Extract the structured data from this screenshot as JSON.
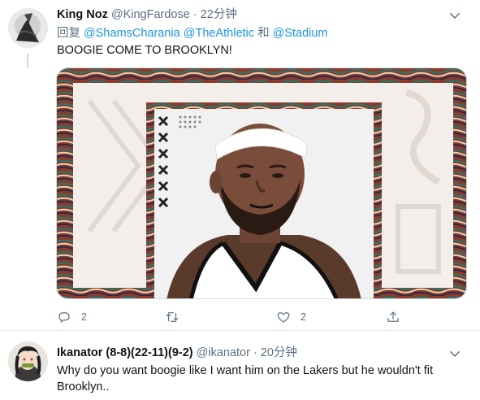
{
  "tweet1": {
    "display_name": "King Noz",
    "handle": "@KingFardose",
    "separator": "·",
    "time": "22分钟",
    "reply_prefix": "回复",
    "mention_1": "@ShamsCharania",
    "mention_2": "@TheAthletic",
    "conjunction": "和",
    "mention_3": "@Stadium",
    "text": "BOOGIE COME TO BROOKLYN!",
    "actions": {
      "reply_count": "2",
      "retweet_count": "",
      "like_count": "2"
    }
  },
  "tweet2": {
    "display_name": "Ikanator (8-8)(22-11)(9-2)",
    "handle": "@ikanator",
    "separator": "·",
    "time": "20分钟",
    "text": "Why do you want boogie like I want him on the Lakers but he wouldn't fit Brooklyn.."
  },
  "icons": {
    "more": "chevron-down-icon",
    "reply": "comment-icon",
    "retweet": "retweet-icon",
    "like": "heart-icon",
    "share": "share-icon"
  },
  "colors": {
    "link": "#1b95e0",
    "secondary_text": "#5b7083",
    "divider": "#e6ecf0"
  }
}
